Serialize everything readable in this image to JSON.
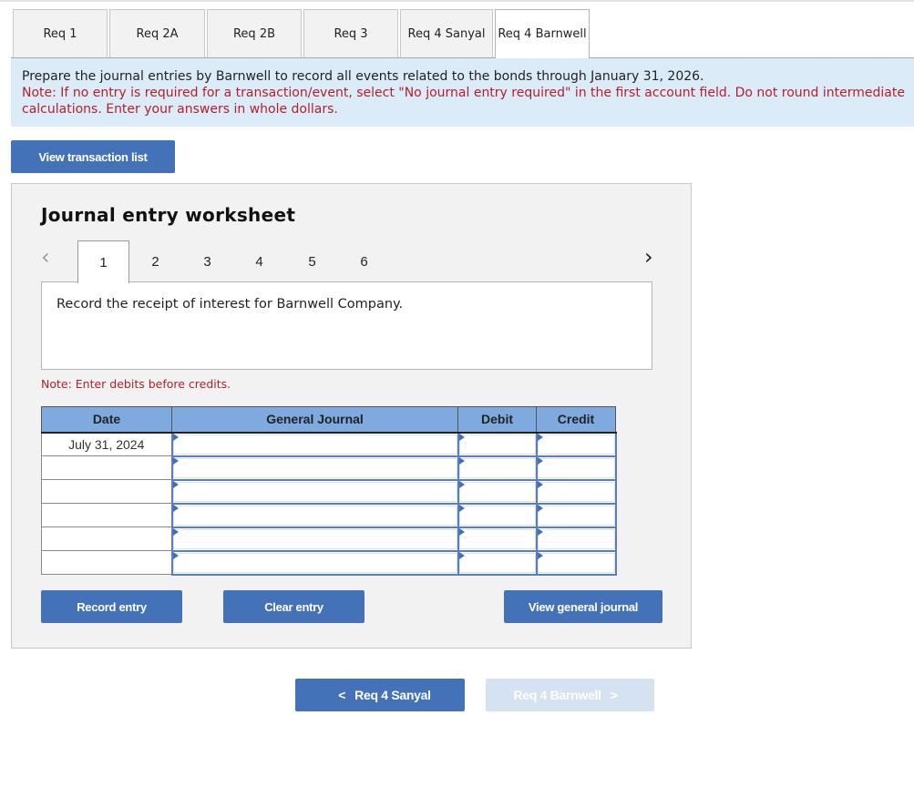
{
  "tabs": [
    {
      "label": "Req 1",
      "active": false
    },
    {
      "label": "Req 2A",
      "active": false
    },
    {
      "label": "Req 2B",
      "active": false
    },
    {
      "label": "Req 3",
      "active": false
    },
    {
      "label": "Req 4 Sanyal",
      "active": false
    },
    {
      "label": "Req 4 Barnwell",
      "active": true
    }
  ],
  "instructions": {
    "main": "Prepare the journal entries by Barnwell to record all events related to the bonds through January 31, 2026.",
    "note": "Note: If no entry is required for a transaction/event, select \"No journal entry required\" in the first account field. Do not round intermediate calculations. Enter your answers in whole dollars."
  },
  "buttons": {
    "view_transaction_list": "View transaction list",
    "record_entry": "Record entry",
    "clear_entry": "Clear entry",
    "view_general_journal": "View general journal"
  },
  "worksheet": {
    "title": "Journal entry worksheet",
    "pages": [
      "1",
      "2",
      "3",
      "4",
      "5",
      "6"
    ],
    "active_page": "1",
    "prev_icon": "‹",
    "next_icon": "›",
    "description": "Record the receipt of interest for Barnwell Company.",
    "note": "Note: Enter debits before credits."
  },
  "table": {
    "headers": {
      "date": "Date",
      "general_journal": "General Journal",
      "debit": "Debit",
      "credit": "Credit"
    },
    "rows": [
      {
        "date": "July 31, 2024",
        "account": "",
        "debit": "",
        "credit": ""
      },
      {
        "date": "",
        "account": "",
        "debit": "",
        "credit": ""
      },
      {
        "date": "",
        "account": "",
        "debit": "",
        "credit": ""
      },
      {
        "date": "",
        "account": "",
        "debit": "",
        "credit": ""
      },
      {
        "date": "",
        "account": "",
        "debit": "",
        "credit": ""
      },
      {
        "date": "",
        "account": "",
        "debit": "",
        "credit": ""
      }
    ]
  },
  "nav": {
    "prev_label": "Req 4 Sanyal",
    "next_label": "Req 4 Barnwell",
    "prev_icon": "<",
    "next_icon": ">",
    "next_disabled": true
  },
  "colors": {
    "primary_button": "#4472b8",
    "disabled_button": "#d5e2f1",
    "instruction_bg": "#dcebf8",
    "note_red": "#b3202b",
    "table_header": "#7eaae0"
  }
}
